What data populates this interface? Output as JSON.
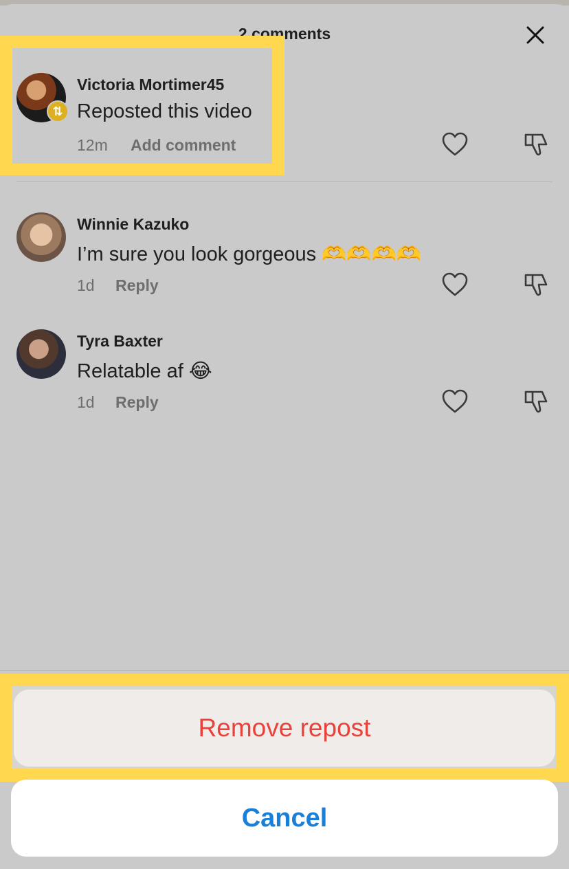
{
  "comments_sheet": {
    "title": "2 comments",
    "close_icon": "close-icon"
  },
  "comments": [
    {
      "username": "Victoria Mortimer45",
      "text": "Reposted this video",
      "time": "12m",
      "action": "Add comment",
      "badge_icon": "repost-icon"
    },
    {
      "username": "Winnie Kazuko",
      "text": "I’m sure you look gorgeous 🫶🫶🫶🫶",
      "time": "1d",
      "action": "Reply"
    },
    {
      "username": "Tyra Baxter",
      "text": "Relatable af 😂",
      "time": "1d",
      "action": "Reply"
    }
  ],
  "action_sheet": {
    "remove_label": "Remove repost",
    "cancel_label": "Cancel"
  },
  "colors": {
    "highlight": "#ffd850",
    "destructive": "#e8423a",
    "accent": "#1a7fd8",
    "repost_badge": "#ddb021"
  }
}
